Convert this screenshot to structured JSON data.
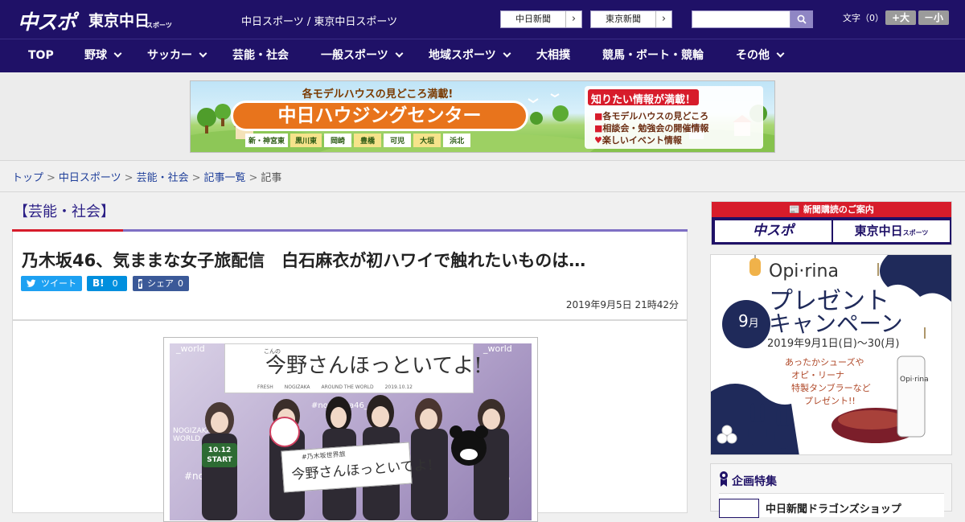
{
  "header": {
    "logo_chusupo": "中スポ",
    "logo_tokyo": "東京中日",
    "logo_tokyo_small": "スポーツ",
    "site_links": "中日スポーツ / 東京中日スポーツ",
    "paper_buttons": [
      "中日新聞",
      "東京新聞"
    ],
    "font_size_label": "文字（0）",
    "font_size_buttons": [
      "+大",
      "－小"
    ]
  },
  "nav": {
    "items": [
      {
        "label": "TOP"
      },
      {
        "label": "野球"
      },
      {
        "label": "サッカー"
      },
      {
        "label": "芸能・社会"
      },
      {
        "label": "一般スポーツ"
      },
      {
        "label": "地域スポーツ"
      },
      {
        "label": "大相撲"
      },
      {
        "label": "競馬・ボート・競輪"
      },
      {
        "label": "その他"
      }
    ]
  },
  "banner": {
    "top_line": "各モデルハウスの見どころ満載!",
    "title": "中日ハウジングセンター",
    "locations": [
      "新・神宮東",
      "黒川東",
      "岡崎",
      "豊橋",
      "可児",
      "大垣",
      "浜北"
    ],
    "box_title": "知りたい情報が満載！",
    "box_lines": [
      "各モデルハウスの見どころ",
      "相談会・勉強会の開催情報",
      "楽しいイベント情報"
    ]
  },
  "breadcrumb": {
    "items": [
      "トップ",
      "中日スポーツ",
      "芸能・社会",
      "記事一覧"
    ],
    "current": "記事"
  },
  "article": {
    "category": "【芸能・社会】",
    "headline": "乃木坂46、気ままな女子旅配信　白石麻衣が初ハワイで触れたいものは…",
    "tweet_label": "ツイート",
    "hatena_label": "B!",
    "hatena_count": "0",
    "fb_label": "シェア",
    "fb_count": "0",
    "date": "2019年9月5日 21時42分",
    "photo": {
      "sign_small": "こんの",
      "sign_title": "今野さんほっといてよ!",
      "sign_sub_left": "FRESH",
      "sign_sub_mid": "NOGIZAKA",
      "sign_sub_right": "AROUND THE WORLD",
      "sign_date": "2019.10.12",
      "wall_text_left": "NOGIZAKA46 WORLD",
      "wall_text_right": "#nogizaka46_world",
      "wall_world": "_world",
      "wall_n46": "46",
      "wall_noji": "#nogi",
      "start_sign_date": "10.12",
      "start_sign_word": "START",
      "card_top": "#乃木坂世界旅",
      "card_title": "今野さんほっといてよ!"
    }
  },
  "sidebar": {
    "subscription_head": "新聞購読のご案内",
    "sub_logo_1": "中スポ",
    "sub_logo_2": "東京中日",
    "sub_logo_2_small": "スポーツ",
    "ad": {
      "brand": "Opi·rina",
      "title_line1": "プレゼント",
      "title_line2": "キャンペーン",
      "month": "9",
      "month_unit": "月",
      "dates": "2019年9月1日(日)～30(月)",
      "line1": "あったかシューズや",
      "line2": "オピ・リーナ",
      "line3": "特製タンブラーなど",
      "line4": "プレゼント!!",
      "tumbler_brand": "Opi·rina"
    },
    "kikaku_title": "企画特集",
    "kikaku_item": "中日新聞ドラゴンズショップ"
  },
  "colors": {
    "header_bg": "#1f1167",
    "accent_red": "#d71c2b",
    "accent_purple": "#7e6fc4",
    "link_blue": "#1f3f9a",
    "twitter": "#1da1f2",
    "hatena": "#008fde",
    "facebook": "#3b5998"
  }
}
